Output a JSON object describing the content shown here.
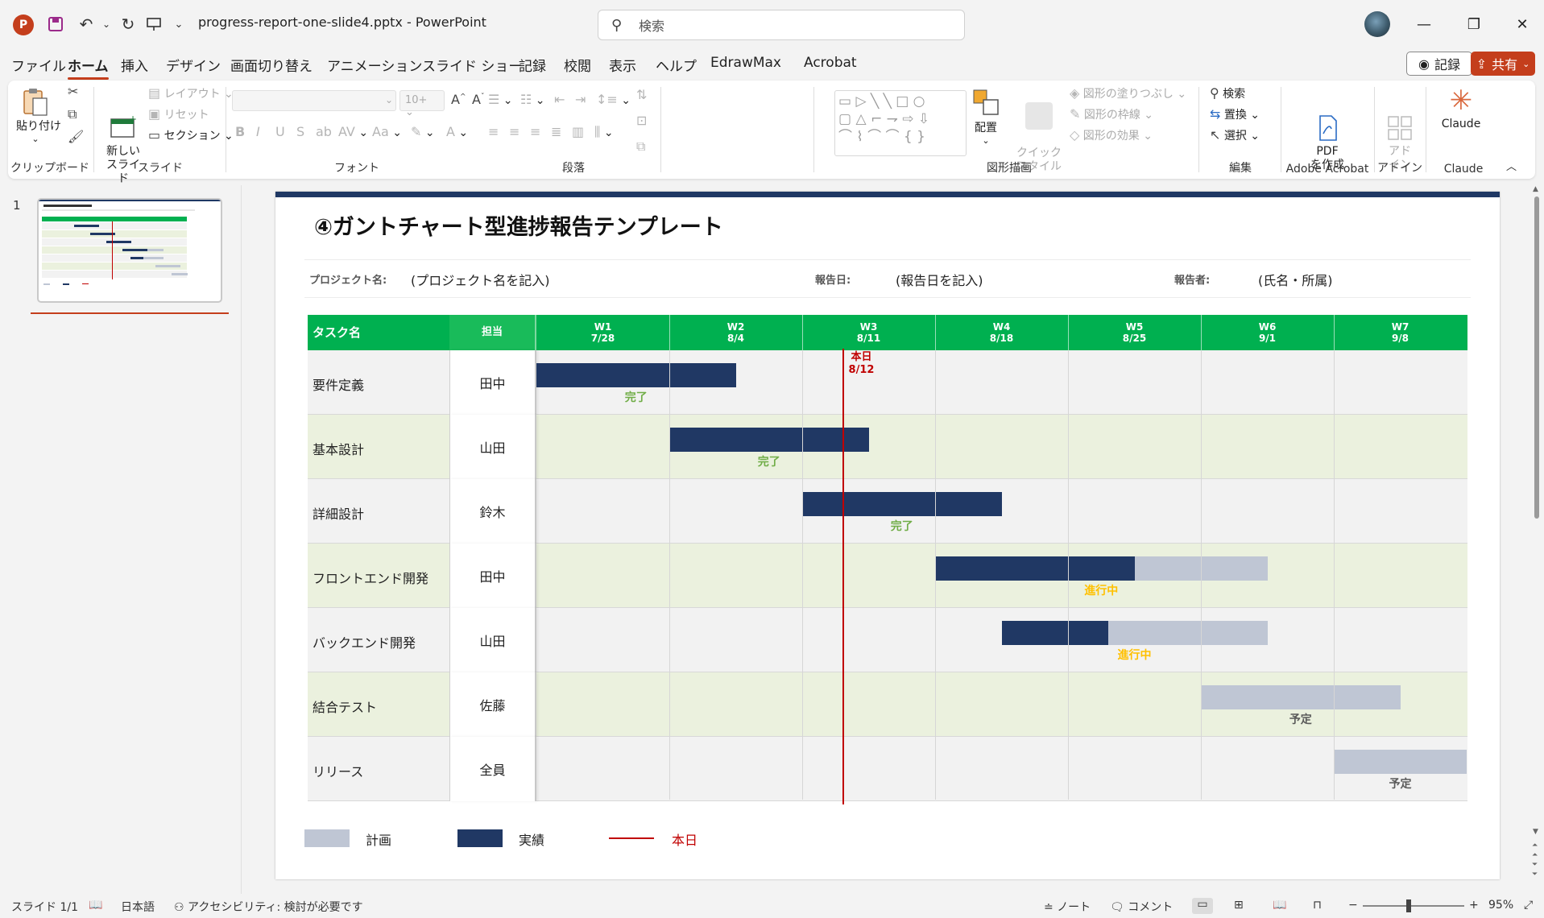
{
  "titlebar": {
    "app_icon": "P",
    "doc_title": "progress-report-one-slide4.pptx  -  PowerPoint",
    "search_placeholder": "検索"
  },
  "menu": {
    "tabs": [
      "ファイル",
      "ホーム",
      "挿入",
      "デザイン",
      "画面切り替え",
      "アニメーション",
      "スライド ショー",
      "記録",
      "校閲",
      "表示",
      "ヘルプ",
      "EdrawMax",
      "Acrobat"
    ],
    "active": "ホーム",
    "record_label": "記録",
    "share_label": "共有"
  },
  "ribbon": {
    "clipboard": {
      "paste": "貼り付け",
      "label": "クリップボード"
    },
    "slides": {
      "new_slide": "新しい\nスライド",
      "layout": "レイアウト",
      "reset": "リセット",
      "section": "セクション",
      "label": "スライド"
    },
    "font": {
      "size": "10+",
      "label": "フォント"
    },
    "paragraph": {
      "label": "段落"
    },
    "drawing": {
      "arrange": "配置",
      "quick_style": "クイック\nスタイル",
      "fill": "図形の塗りつぶし",
      "outline": "図形の枠線",
      "effects": "図形の効果",
      "label": "図形描画"
    },
    "editing": {
      "find": "検索",
      "replace": "置換",
      "select": "選択",
      "label": "編集"
    },
    "acrobat": {
      "create_pdf": "PDF\nを作成",
      "label": "Adobe Acrobat"
    },
    "addin": {
      "addin": "アド\nイン",
      "label": "アドイン"
    },
    "claude": {
      "claude": "Claude",
      "label": "Claude"
    }
  },
  "thumbnail": {
    "number": "1"
  },
  "slide": {
    "title": "④ガントチャート型進捗報告テンプレート",
    "info": {
      "project_label": "プロジェクト名:",
      "project_value": "(プロジェクト名を記入)",
      "date_label": "報告日:",
      "date_value": "(報告日を記入)",
      "reporter_label": "報告者:",
      "reporter_value": "(氏名・所属)"
    },
    "gantt": {
      "col_task": "タスク名",
      "col_owner": "担当",
      "weeks": [
        {
          "w": "W1",
          "d": "7/28"
        },
        {
          "w": "W2",
          "d": "8/4"
        },
        {
          "w": "W3",
          "d": "8/11"
        },
        {
          "w": "W4",
          "d": "8/18"
        },
        {
          "w": "W5",
          "d": "8/25"
        },
        {
          "w": "W6",
          "d": "9/1"
        },
        {
          "w": "W7",
          "d": "9/8"
        }
      ],
      "today_label": "本日",
      "today_date": "8/12",
      "today_week_pos": 2.3,
      "tasks": [
        {
          "name": "要件定義",
          "owner": "田中",
          "plan": [
            0,
            1.5
          ],
          "actual": [
            0,
            1.5
          ],
          "status": "完了",
          "status_color": "#70ad47"
        },
        {
          "name": "基本設計",
          "owner": "山田",
          "plan": [
            1,
            2.5
          ],
          "actual": [
            1,
            2.5
          ],
          "status": "完了",
          "status_color": "#70ad47"
        },
        {
          "name": "詳細設計",
          "owner": "鈴木",
          "plan": [
            2,
            3.5
          ],
          "actual": [
            2,
            3.5
          ],
          "status": "完了",
          "status_color": "#70ad47"
        },
        {
          "name": "フロントエンド開発",
          "owner": "田中",
          "plan": [
            3,
            5.5
          ],
          "actual": [
            3,
            4.5
          ],
          "status": "進行中",
          "status_color": "#ffc000"
        },
        {
          "name": "バックエンド開発",
          "owner": "山田",
          "plan": [
            3.5,
            5.5
          ],
          "actual": [
            3.5,
            4.3
          ],
          "status": "進行中",
          "status_color": "#ffc000"
        },
        {
          "name": "結合テスト",
          "owner": "佐藤",
          "plan": [
            5,
            6.5
          ],
          "actual": null,
          "status": "予定",
          "status_color": "#595959"
        },
        {
          "name": "リリース",
          "owner": "全員",
          "plan": [
            6,
            7
          ],
          "actual": null,
          "status": "予定",
          "status_color": "#595959"
        }
      ]
    },
    "legend": {
      "plan": "計画",
      "actual": "実績",
      "today": "本日"
    }
  },
  "colors": {
    "accent": "#c43e1c",
    "header_green": "#00b050",
    "actual": "#203864",
    "plan": "#bfc6d4",
    "today": "#c00000"
  },
  "statusbar": {
    "slide": "スライド 1/1",
    "language": "日本語",
    "accessibility": "アクセシビリティ: 検討が必要です",
    "notes": "ノート",
    "comments": "コメント",
    "zoom": "95%"
  }
}
